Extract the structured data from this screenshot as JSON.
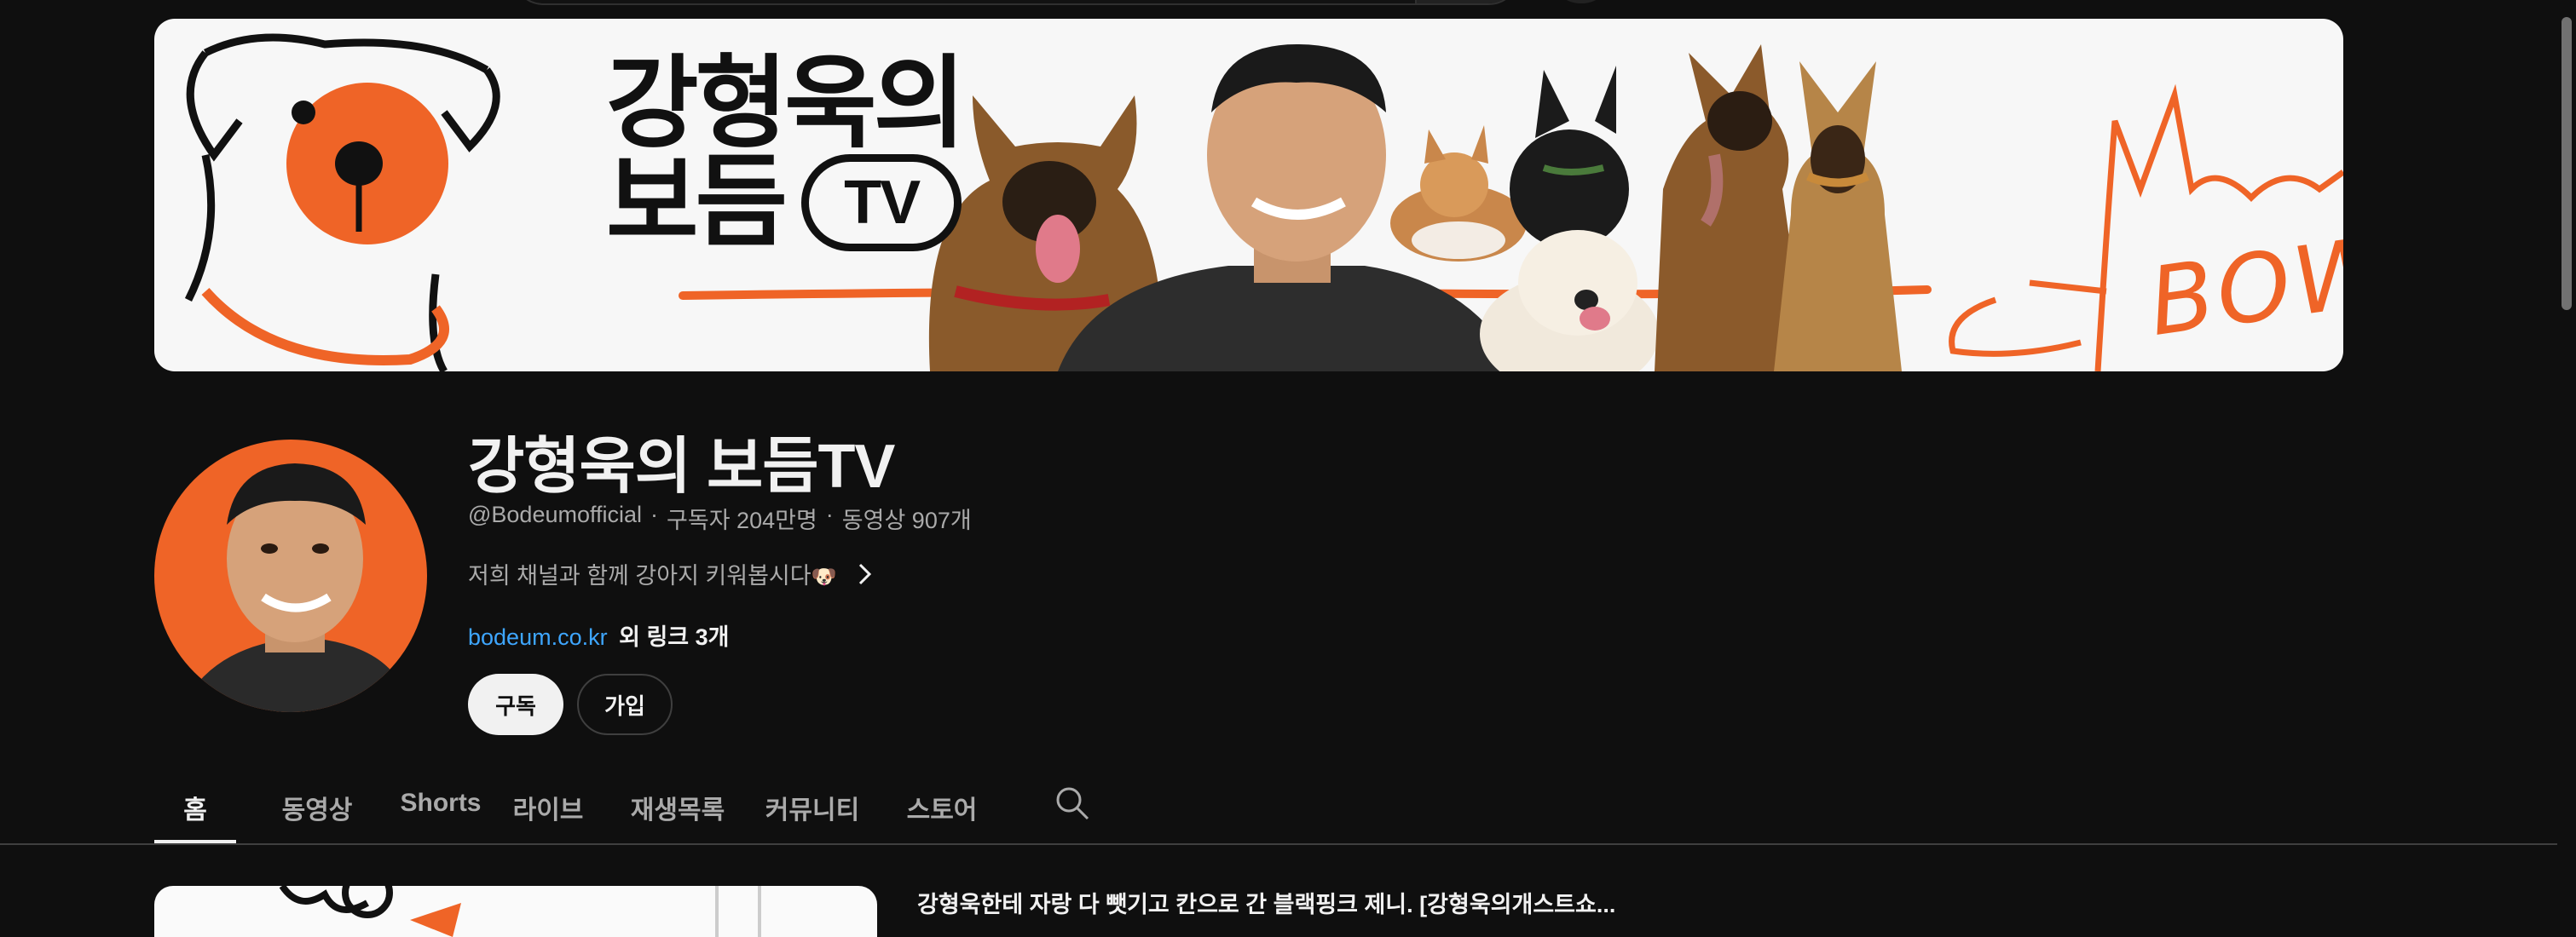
{
  "banner": {
    "title_line1": "강형욱의",
    "title_line2": "보듬",
    "title_badge": "TV",
    "bow_text": "BOW"
  },
  "channel": {
    "name": "강형욱의 보듬TV",
    "handle": "@Bodeumofficial",
    "subscribers": "구독자 204만명",
    "videos": "동영상 907개",
    "description": "저희 채널과 함께 강아지 키워봅시다",
    "description_emoji": "🐶",
    "link_text": "bodeum.co.kr",
    "more_links": "외 링크 3개",
    "subscribe_label": "구독",
    "join_label": "가입"
  },
  "tabs": [
    {
      "label": "홈",
      "active": true
    },
    {
      "label": "동영상",
      "active": false
    },
    {
      "label": "Shorts",
      "active": false
    },
    {
      "label": "라이브",
      "active": false
    },
    {
      "label": "재생목록",
      "active": false
    },
    {
      "label": "커뮤니티",
      "active": false
    },
    {
      "label": "스토어",
      "active": false
    }
  ],
  "featured_video": {
    "title": "강형욱한테 자랑 다 뺏기고 칸으로 간 블랙핑크 제니. [강형욱의개스트쇼..."
  },
  "colors": {
    "background": "#0f0f0f",
    "accent_orange": "#ef6427",
    "link_blue": "#3ea6ff",
    "text_secondary": "#aaaaaa"
  }
}
